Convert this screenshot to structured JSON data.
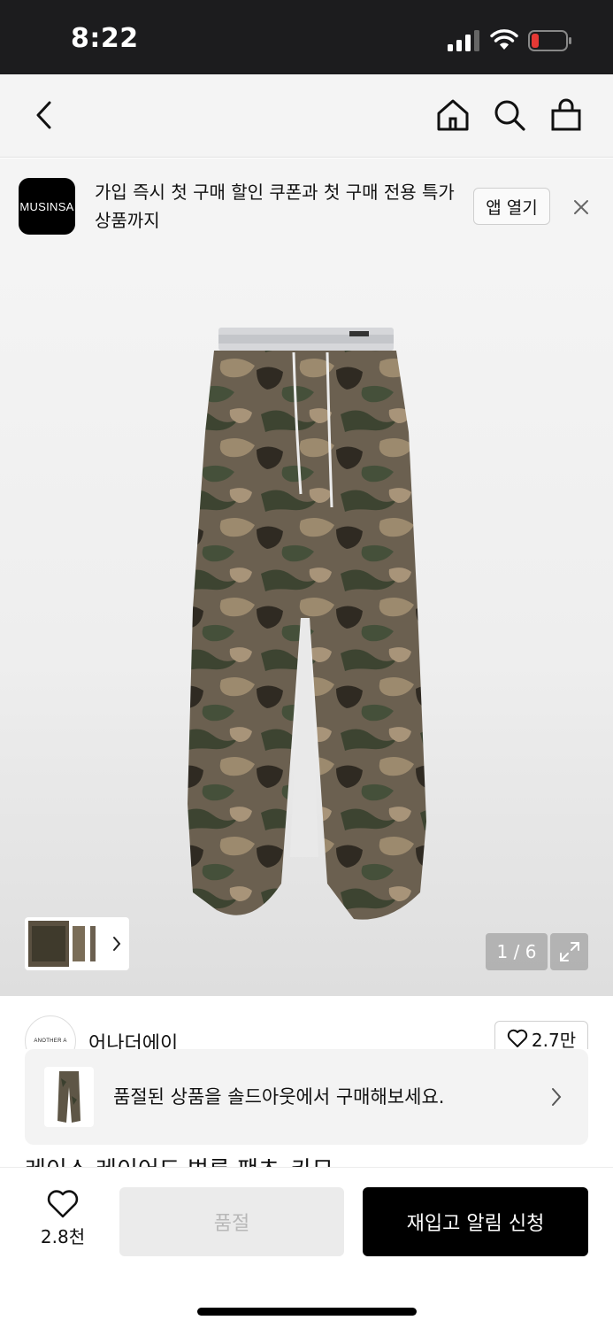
{
  "status_bar": {
    "time": "8:22"
  },
  "app_banner": {
    "logo_text": "MUSINSA",
    "message": "가입 즉시 첫 구매 할인 쿠폰과 첫 구매 전용 특가 상품까지",
    "open_label": "앱 열기"
  },
  "gallery": {
    "counter": "1 / 6"
  },
  "brand": {
    "logo_text": "ANOTHER A",
    "name": "어나더에이",
    "likes": "2.7만"
  },
  "soldout_banner": {
    "text": "품절된 상품을 솔드아웃에서 구매해보세요."
  },
  "product": {
    "title": "레이스 레이어드 벌룬 팬츠_카모"
  },
  "bottom_bar": {
    "wish_count": "2.8천",
    "soldout_label": "품절",
    "restock_label": "재입고 알림 신청"
  },
  "colors": {
    "accent": "#000000",
    "status_bar_bg": "#1c1c1e",
    "battery_low": "#e53935"
  },
  "icons": [
    "back-arrow-icon",
    "home-icon",
    "search-icon",
    "shopping-bag-icon",
    "close-icon",
    "chevron-right-icon",
    "expand-icon",
    "heart-icon"
  ]
}
